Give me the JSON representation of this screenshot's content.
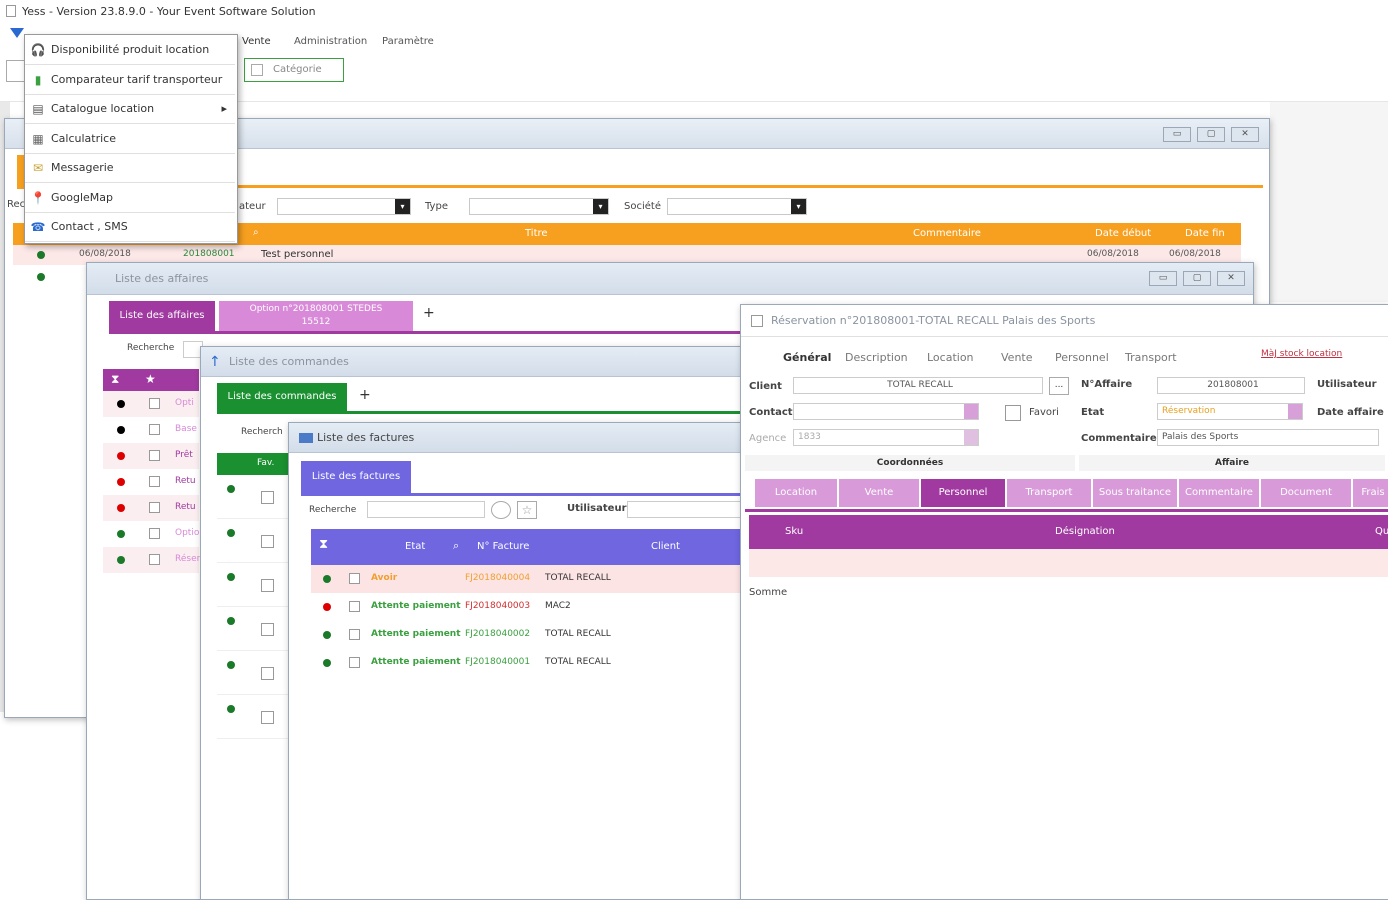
{
  "app": {
    "title": "Yess - Version 23.8.9.0 - Your Event Software Solution"
  },
  "topbar": {
    "tabs": [
      "Vente",
      "Administration",
      "Paramètre"
    ],
    "category": "Catégorie"
  },
  "menu": {
    "items": [
      {
        "label": "Disponibilité produit location",
        "icon": "headset-icon"
      },
      {
        "label": "Comparateur tarif transporteur",
        "icon": "bar-chart-icon"
      },
      {
        "label": "Catalogue location",
        "icon": "catalog-icon",
        "arrow": "▸"
      },
      {
        "label": "Calculatrice",
        "icon": "calculator-icon"
      },
      {
        "label": "Messagerie",
        "icon": "mail-icon"
      },
      {
        "label": "GoogleMap",
        "icon": "map-pin-icon"
      },
      {
        "label": "Contact , SMS",
        "icon": "contact-icon"
      }
    ]
  },
  "bg_window": {
    "filters": {
      "prefix": "Rec",
      "creator": "ateur",
      "type": "Type",
      "company": "Société"
    },
    "headers": [
      "Titre",
      "Commentaire",
      "Date début",
      "Date fin"
    ],
    "rows": [
      {
        "date": "06/08/2018",
        "number": "201808001",
        "title": "Test personnel",
        "start": "06/08/2018",
        "end": "06/08/2018",
        "color": "#1a7a2a"
      },
      {
        "date": "",
        "number": "",
        "title": "",
        "start": "",
        "end": "",
        "color": "#1a7a2a"
      }
    ]
  },
  "affaires": {
    "title": "Liste des affaires",
    "tabs": [
      "Liste des affaires",
      "Option n°201808001 STEDES 15512"
    ],
    "add": "+",
    "search": "Recherche",
    "rows": [
      {
        "color": "#000",
        "label": "Opti"
      },
      {
        "color": "#000",
        "label": "Base"
      },
      {
        "color": "#d00",
        "label": "Prêt"
      },
      {
        "color": "#d00",
        "label": "Retu"
      },
      {
        "color": "#d00",
        "label": "Retu"
      },
      {
        "color": "#1a7a2a",
        "label": "Optio"
      },
      {
        "color": "#1a7a2a",
        "label": "Réser"
      }
    ]
  },
  "commandes": {
    "title": "Liste des commandes",
    "tab": "Liste des commandes",
    "add": "+",
    "search": "Recherch",
    "col": "Fav.",
    "rows": [
      {
        "color": "#1a7a2a"
      },
      {
        "color": "#1a7a2a"
      },
      {
        "color": "#1a7a2a"
      },
      {
        "color": "#1a7a2a"
      },
      {
        "color": "#1a7a2a"
      },
      {
        "color": "#1a7a2a"
      }
    ]
  },
  "factures": {
    "title": "Liste des factures",
    "tab": "Liste des factures",
    "search": "Recherche",
    "user": "Utilisateur",
    "headers": {
      "state": "Etat",
      "number": "N° Facture",
      "client": "Client"
    },
    "rows": [
      {
        "color": "#1a7a2a",
        "state": "Avoir",
        "number": "FJ2018040004",
        "client": "TOTAL RECALL",
        "state_color": "#f0a030",
        "number_color": "#f0a030",
        "bg": "#fde4e4"
      },
      {
        "color": "#d00",
        "state": "Attente paiement",
        "number": "FJ2018040003",
        "client": "MAC2",
        "state_color": "#3aa040",
        "number_color": "#d03030",
        "bg": "#fff"
      },
      {
        "color": "#1a7a2a",
        "state": "Attente paiement",
        "number": "FJ2018040002",
        "client": "TOTAL RECALL",
        "state_color": "#3aa040",
        "number_color": "#3aa040",
        "bg": "#fff"
      },
      {
        "color": "#1a7a2a",
        "state": "Attente paiement",
        "number": "FJ2018040001",
        "client": "TOTAL RECALL",
        "state_color": "#3aa040",
        "number_color": "#3aa040",
        "bg": "#fff"
      }
    ]
  },
  "reservation": {
    "title": "Réservation n°201808001-TOTAL RECALL Palais des Sports",
    "tabs": [
      "Général",
      "Description",
      "Location",
      "Vente",
      "Personnel",
      "Transport"
    ],
    "link": "MàJ stock location",
    "fields": {
      "client_label": "Client",
      "client_value": "TOTAL RECALL",
      "client_btn": "...",
      "contact_label": "Contact",
      "fav_label": "Favori",
      "agency_label": "Agence",
      "agency_value": "1833",
      "affaire_label": "N°Affaire",
      "affaire_value": "201808001",
      "user_label": "Utilisateur",
      "state_label": "Etat",
      "state_value": "Réservation",
      "date_label": "Date affaire",
      "comment_label": "Commentaire",
      "comment_value": "Palais des Sports"
    },
    "section_left": "Coordonnées",
    "section_right": "Affaire",
    "subtabs": [
      "Location",
      "Vente",
      "Personnel",
      "Transport",
      "Sous traitance",
      "Commentaire",
      "Document",
      "Frais"
    ],
    "table_headers": [
      "Sku",
      "Désignation",
      "Qu"
    ],
    "sum": "Somme"
  },
  "colors": {
    "orange": "#f7a020",
    "purple": "#a03aa0",
    "green": "#1a9030",
    "blue": "#6f66e0"
  }
}
